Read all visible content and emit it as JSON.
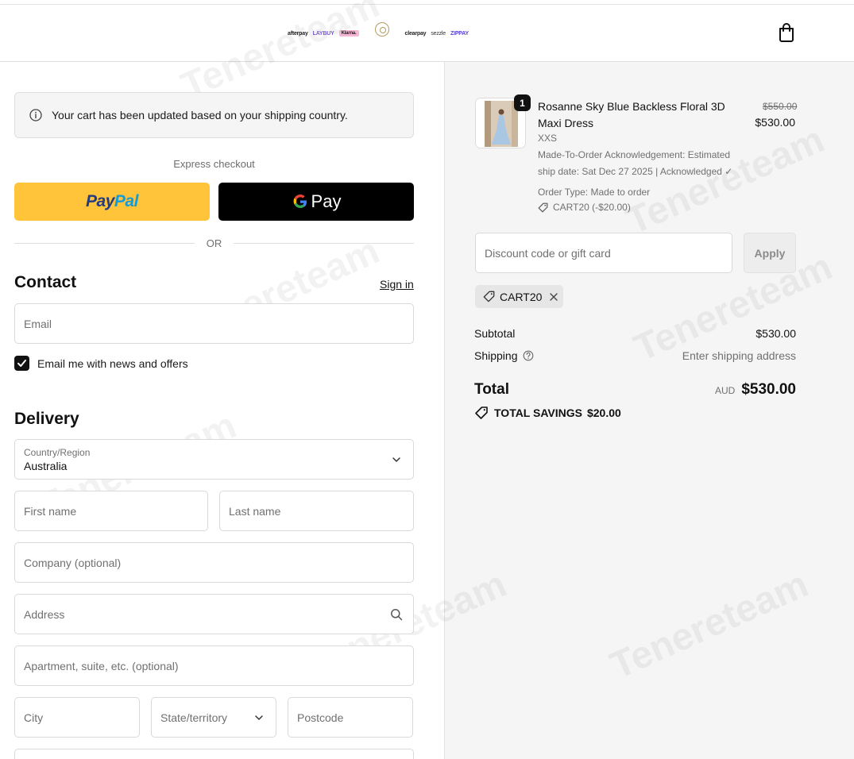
{
  "header": {
    "payment_logos": [
      "afterpay",
      "LAYBUY",
      "Klarna.",
      "clearpay",
      "sezzle",
      "ZIPPAY"
    ],
    "brand_logo": "brand-logo",
    "cart_icon": "shopping-bag-icon"
  },
  "notice": {
    "icon": "info-icon",
    "text": "Your cart has been updated based on your shipping country."
  },
  "express": {
    "label": "Express checkout",
    "paypal_label_1": "Pay",
    "paypal_label_2": "Pal",
    "gpay_label": "Pay",
    "or_label": "OR"
  },
  "contact": {
    "title": "Contact",
    "signin": "Sign in",
    "email_placeholder": "Email",
    "newsletter_label": "Email me with news and offers",
    "newsletter_checked": true
  },
  "delivery": {
    "title": "Delivery",
    "country_label": "Country/Region",
    "country_value": "Australia",
    "first_name": "First name",
    "last_name": "Last name",
    "company": "Company (optional)",
    "address": "Address",
    "apartment": "Apartment, suite, etc. (optional)",
    "city": "City",
    "state": "State/territory",
    "postcode": "Postcode"
  },
  "order": {
    "item": {
      "quantity": "1",
      "name": "Rosanne Sky Blue Backless Floral 3D Maxi Dress",
      "size": "XXS",
      "acknowledgement_1": "Made-To-Order Acknowledgement: Estimated",
      "acknowledgement_2": "ship date: Sat Dec 27 2025 | Acknowledged ✓",
      "order_type": "Order Type: Made to order",
      "discount": "CART20 (-$20.00)",
      "original_price": "$550.00",
      "price": "$530.00"
    },
    "discount_placeholder": "Discount code or gift card",
    "apply_label": "Apply",
    "applied_code": "CART20",
    "subtotal_label": "Subtotal",
    "subtotal_value": "$530.00",
    "shipping_label": "Shipping",
    "shipping_value": "Enter shipping address",
    "total_label": "Total",
    "total_currency": "AUD",
    "total_value": "$530.00",
    "savings_label": "TOTAL SAVINGS",
    "savings_value": "$20.00"
  },
  "watermark": "Tenereteam",
  "colors": {
    "paypal_yellow": "#ffc43a",
    "paypal_blue_dark": "#253b80",
    "paypal_blue_light": "#179bd7",
    "summary_bg": "#f5f5f5"
  }
}
